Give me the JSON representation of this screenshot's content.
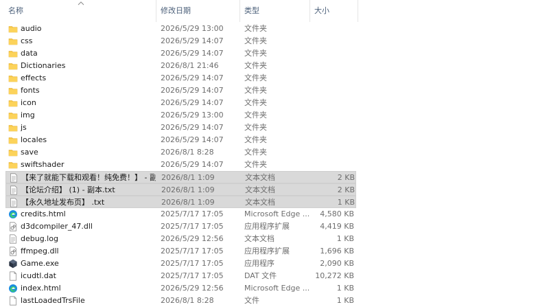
{
  "header": {
    "columns": [
      "名称",
      "修改日期",
      "类型",
      "大小"
    ]
  },
  "icons": {
    "folder": "folder-icon",
    "text": "text-file-icon",
    "edge": "edge-html-icon",
    "dll": "dll-file-icon",
    "exe": "game-exe-icon",
    "generic": "generic-file-icon"
  },
  "colors": {
    "folder": "#f7c842",
    "selection": "#d9d9d9",
    "header_text": "#4c607a"
  },
  "files": [
    {
      "name": "audio",
      "date": "2026/5/29 13:00",
      "type": "文件夹",
      "size": "",
      "icon": "folder",
      "selected": false
    },
    {
      "name": "css",
      "date": "2026/5/29 14:07",
      "type": "文件夹",
      "size": "",
      "icon": "folder",
      "selected": false
    },
    {
      "name": "data",
      "date": "2026/5/29 14:07",
      "type": "文件夹",
      "size": "",
      "icon": "folder",
      "selected": false
    },
    {
      "name": "Dictionaries",
      "date": "2026/8/1 21:46",
      "type": "文件夹",
      "size": "",
      "icon": "folder",
      "selected": false
    },
    {
      "name": "effects",
      "date": "2026/5/29 14:07",
      "type": "文件夹",
      "size": "",
      "icon": "folder",
      "selected": false
    },
    {
      "name": "fonts",
      "date": "2026/5/29 14:07",
      "type": "文件夹",
      "size": "",
      "icon": "folder",
      "selected": false
    },
    {
      "name": "icon",
      "date": "2026/5/29 14:07",
      "type": "文件夹",
      "size": "",
      "icon": "folder",
      "selected": false
    },
    {
      "name": "img",
      "date": "2026/5/29 13:00",
      "type": "文件夹",
      "size": "",
      "icon": "folder",
      "selected": false
    },
    {
      "name": "js",
      "date": "2026/5/29 14:07",
      "type": "文件夹",
      "size": "",
      "icon": "folder",
      "selected": false
    },
    {
      "name": "locales",
      "date": "2026/5/29 14:07",
      "type": "文件夹",
      "size": "",
      "icon": "folder",
      "selected": false
    },
    {
      "name": "save",
      "date": "2026/8/1 8:28",
      "type": "文件夹",
      "size": "",
      "icon": "folder",
      "selected": false
    },
    {
      "name": "swiftshader",
      "date": "2026/5/29 14:07",
      "type": "文件夹",
      "size": "",
      "icon": "folder",
      "selected": false
    },
    {
      "name": "【来了就能下载和观看！纯免费！】 - 副...",
      "date": "2026/8/1 1:09",
      "type": "文本文档",
      "size": "2 KB",
      "icon": "text",
      "selected": true
    },
    {
      "name": "【论坛介绍】 (1) - 副本.txt",
      "date": "2026/8/1 1:09",
      "type": "文本文档",
      "size": "2 KB",
      "icon": "text",
      "selected": true
    },
    {
      "name": "【永久地址发布页】 .txt",
      "date": "2026/8/1 1:09",
      "type": "文本文档",
      "size": "1 KB",
      "icon": "text",
      "selected": true
    },
    {
      "name": "credits.html",
      "date": "2025/7/17 17:05",
      "type": "Microsoft Edge ...",
      "size": "4,580 KB",
      "icon": "edge",
      "selected": false
    },
    {
      "name": "d3dcompiler_47.dll",
      "date": "2025/7/17 17:05",
      "type": "应用程序扩展",
      "size": "4,419 KB",
      "icon": "dll",
      "selected": false
    },
    {
      "name": "debug.log",
      "date": "2026/5/29 12:56",
      "type": "文本文档",
      "size": "1 KB",
      "icon": "text",
      "selected": false
    },
    {
      "name": "ffmpeg.dll",
      "date": "2025/7/17 17:05",
      "type": "应用程序扩展",
      "size": "1,696 KB",
      "icon": "dll",
      "selected": false
    },
    {
      "name": "Game.exe",
      "date": "2025/7/17 17:05",
      "type": "应用程序",
      "size": "2,090 KB",
      "icon": "exe",
      "selected": false
    },
    {
      "name": "icudtl.dat",
      "date": "2025/7/17 17:05",
      "type": "DAT 文件",
      "size": "10,272 KB",
      "icon": "generic",
      "selected": false
    },
    {
      "name": "index.html",
      "date": "2026/5/29 12:56",
      "type": "Microsoft Edge ...",
      "size": "1 KB",
      "icon": "edge",
      "selected": false
    },
    {
      "name": "lastLoadedTrsFile",
      "date": "2026/8/1 8:28",
      "type": "文件",
      "size": "1 KB",
      "icon": "generic",
      "selected": false
    }
  ]
}
